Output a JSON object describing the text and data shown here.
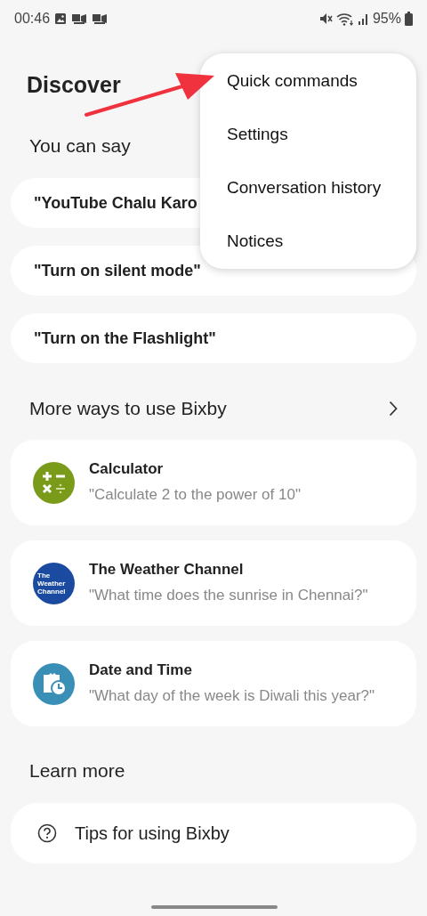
{
  "status_bar": {
    "time": "00:46",
    "battery": "95%"
  },
  "title": "Discover",
  "you_can_say": {
    "heading": "You can say",
    "items": [
      "\"YouTube Chalu Karo",
      "\"Turn on silent mode\"",
      "\"Turn on the Flashlight\""
    ]
  },
  "more_ways": {
    "heading": "More ways to use Bixby",
    "items": [
      {
        "kind": "calculator",
        "title": "Calculator",
        "example": "\"Calculate 2 to the power of 10\""
      },
      {
        "kind": "weather",
        "title": "The Weather Channel",
        "example": "\"What time does the sunrise in Chennai?\"",
        "logo_lines": [
          "The",
          "Weather",
          "Channel"
        ]
      },
      {
        "kind": "datetime",
        "title": "Date and Time",
        "example": "\"What day of the week is Diwali this year?\""
      }
    ]
  },
  "learn_more": {
    "heading": "Learn more",
    "items": [
      "Tips for using Bixby"
    ]
  },
  "menu": {
    "items": [
      "Quick commands",
      "Settings",
      "Conversation history",
      "Notices"
    ]
  }
}
